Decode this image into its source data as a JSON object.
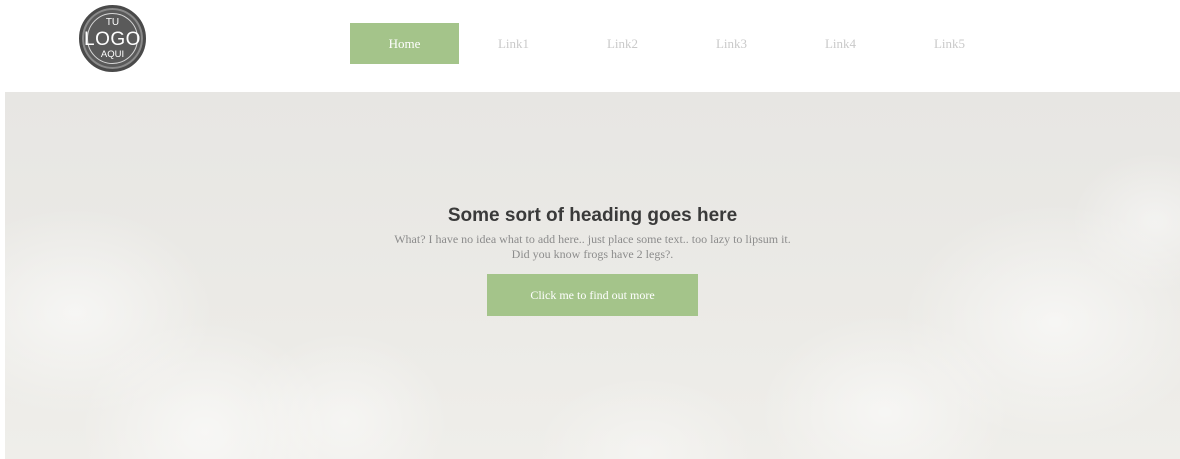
{
  "logo": {
    "line1": "TU",
    "line2": "LOGO",
    "line3": "AQUI"
  },
  "nav": {
    "items": [
      {
        "label": "Home",
        "active": true
      },
      {
        "label": "Link1"
      },
      {
        "label": "Link2"
      },
      {
        "label": "Link3"
      },
      {
        "label": "Link4"
      },
      {
        "label": "Link5"
      }
    ]
  },
  "hero": {
    "title": "Some sort of heading goes here",
    "text_line1": "What? I have no idea what to add here.. just place some text.. too lazy to lipsum it.",
    "text_line2": "Did you know frogs have 2 legs?.",
    "cta_label": "Click me to find out more"
  },
  "colors": {
    "accent": "#a4c48a",
    "nav_inactive": "#c9c9c9",
    "heading": "#3a3a3a",
    "body_text": "#8c8c8c"
  }
}
